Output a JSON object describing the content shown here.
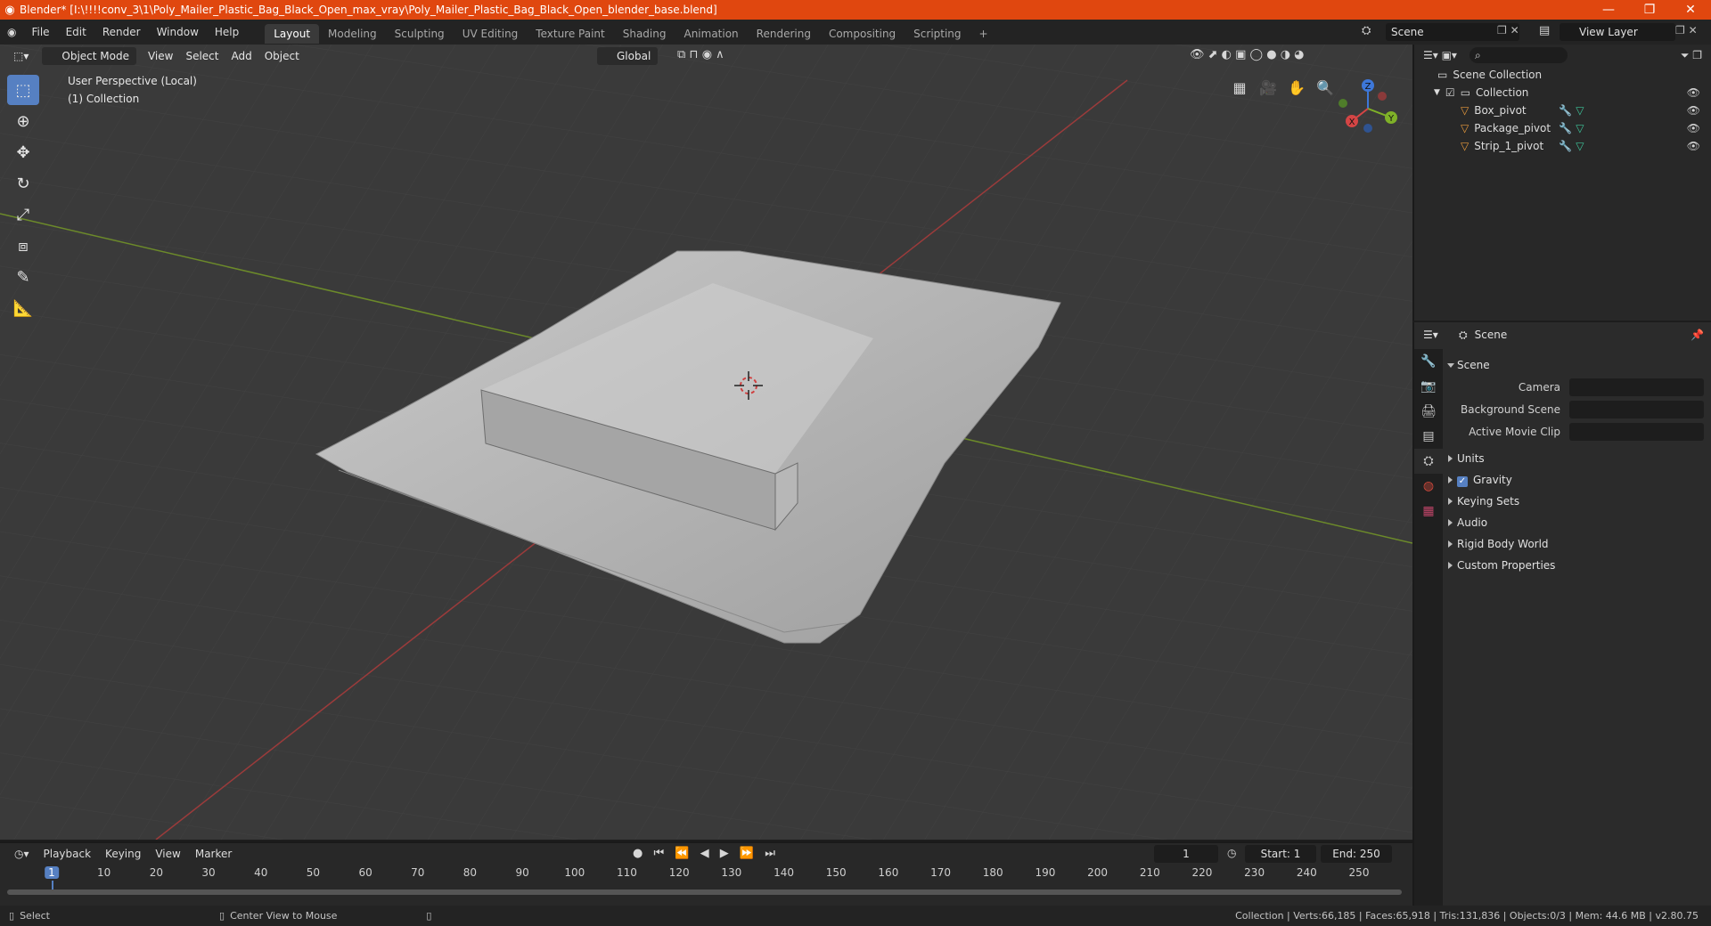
{
  "window": {
    "title": "Blender* [I:\\!!!!conv_3\\1\\Poly_Mailer_Plastic_Bag_Black_Open_max_vray\\Poly_Mailer_Plastic_Bag_Black_Open_blender_base.blend]",
    "controls": [
      "—",
      "❐",
      "✕"
    ]
  },
  "menu": [
    "File",
    "Edit",
    "Render",
    "Window",
    "Help"
  ],
  "workspaces": {
    "active": "Layout",
    "tabs": [
      "Layout",
      "Modeling",
      "Sculpting",
      "UV Editing",
      "Texture Paint",
      "Shading",
      "Animation",
      "Rendering",
      "Compositing",
      "Scripting"
    ],
    "add": "+"
  },
  "scene_selector": {
    "label": "Scene"
  },
  "view_layer": {
    "label": "View Layer"
  },
  "viewport": {
    "mode": "Object Mode",
    "menus": [
      "View",
      "Select",
      "Add",
      "Object"
    ],
    "orientation": "Global",
    "perspective_label": "User Perspective (Local)",
    "collection_label": "(1) Collection",
    "gizmo": {
      "x": "X",
      "y": "Y",
      "z": "Z"
    },
    "colors": {
      "background": "#3a3a3a",
      "x_axis": "#9b3b3b",
      "y_axis": "#6c8a2a",
      "bag": "#bdbdbd"
    }
  },
  "outliner": {
    "search_placeholder": "",
    "root": "Scene Collection",
    "collection": "Collection",
    "objects": [
      "Box_pivot",
      "Package_pivot",
      "Strip_1_pivot"
    ]
  },
  "properties": {
    "header": "Scene",
    "section_title": "Scene",
    "fields": [
      {
        "label": "Camera"
      },
      {
        "label": "Background Scene"
      },
      {
        "label": "Active Movie Clip"
      }
    ],
    "sections": [
      "Units",
      "Gravity",
      "Keying Sets",
      "Audio",
      "Rigid Body World",
      "Custom Properties"
    ],
    "gravity_checked": true
  },
  "timeline": {
    "menus": [
      "Playback",
      "Keying",
      "View",
      "Marker"
    ],
    "current_frame": "1",
    "start_label": "Start:",
    "start": "1",
    "end_label": "End:",
    "end": "250",
    "ruler": [
      "1",
      "10",
      "20",
      "30",
      "40",
      "50",
      "60",
      "70",
      "80",
      "90",
      "100",
      "110",
      "120",
      "130",
      "140",
      "150",
      "160",
      "170",
      "180",
      "190",
      "200",
      "210",
      "220",
      "230",
      "240",
      "250"
    ]
  },
  "status": {
    "left_action": "Select",
    "middle_action": "Center View to Mouse",
    "stats": "Collection | Verts:66,185 | Faces:65,918 | Tris:131,836 | Objects:0/3 | Mem: 44.6 MB | v2.80.75"
  }
}
